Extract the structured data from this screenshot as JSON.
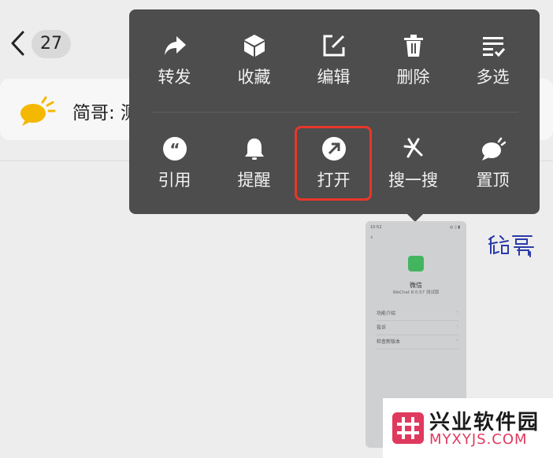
{
  "header": {
    "unread_count": "27"
  },
  "pinned": {
    "text": "简哥: 测"
  },
  "menu": {
    "row1": [
      {
        "label": "转发",
        "icon": "forward-icon"
      },
      {
        "label": "收藏",
        "icon": "favorite-cube-icon"
      },
      {
        "label": "编辑",
        "icon": "edit-icon"
      },
      {
        "label": "删除",
        "icon": "trash-icon"
      },
      {
        "label": "多选",
        "icon": "multi-select-icon"
      }
    ],
    "row2": [
      {
        "label": "引用",
        "icon": "quote-icon"
      },
      {
        "label": "提醒",
        "icon": "bell-icon"
      },
      {
        "label": "打开",
        "icon": "open-arrow-icon"
      },
      {
        "label": "搜一搜",
        "icon": "search-sparkle-icon"
      },
      {
        "label": "置顶",
        "icon": "pin-top-icon"
      }
    ],
    "highlighted": "打开",
    "highlight_color": "#e8362a"
  },
  "thumbnail": {
    "status_left": "10:52",
    "status_right": "◎ ▯ ▮",
    "app_name": "微信",
    "version": "WeChat 8.0.57 测试版",
    "rows": [
      "功能介绍",
      "投诉",
      "检查新版本"
    ]
  },
  "signature": "简哥",
  "watermark": {
    "title": "兴业软件园",
    "url": "MYXYJS.COM",
    "color": "#e0395f"
  },
  "colors": {
    "menu_bg": "#4d4d4d",
    "page_bg": "#ededed",
    "pin_icon": "#f5b800"
  }
}
